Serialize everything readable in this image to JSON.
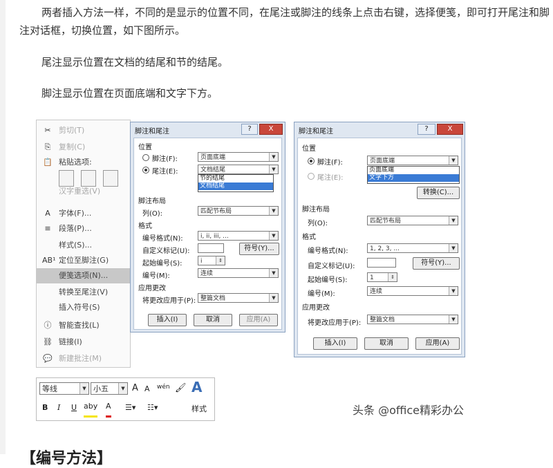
{
  "article": {
    "p1_line1": "两者插入方法一样，不同的是显示的位置不同，在尾注或脚注的线条上点击右键，选择便笺，即可打开尾注和脚",
    "p1_line2": "注对话框，切换位置，如下图所示。",
    "p2": "尾注显示位置在文档的结尾和节的结尾。",
    "p3": "脚注显示位置在页面底端和文字下方。",
    "heading": "【编号方法】"
  },
  "context_menu": {
    "items": [
      {
        "icon": "scissors-icon",
        "glyph": "✂",
        "label": "剪切(T)",
        "disabled": true
      },
      {
        "icon": "copy-icon",
        "glyph": "⎘",
        "label": "复制(C)",
        "disabled": true
      },
      {
        "icon": "paste-icon",
        "glyph": "📋",
        "label": "粘贴选项:",
        "disabled": false
      },
      {
        "icon": "",
        "glyph": "",
        "label": "汉字重选(V)",
        "disabled": true
      },
      {
        "icon": "font-icon",
        "glyph": "A",
        "label": "字体(F)...",
        "disabled": false
      },
      {
        "icon": "paragraph-icon",
        "glyph": "≡",
        "label": "段落(P)...",
        "disabled": false
      },
      {
        "icon": "",
        "glyph": "",
        "label": "样式(S)...",
        "disabled": false
      },
      {
        "icon": "footnote-icon",
        "glyph": "AB¹",
        "label": "定位至脚注(G)",
        "disabled": false
      },
      {
        "icon": "",
        "glyph": "",
        "label": "便笺选项(N)...",
        "disabled": false,
        "highlighted": true
      },
      {
        "icon": "",
        "glyph": "",
        "label": "转换至尾注(V)",
        "disabled": false
      },
      {
        "icon": "",
        "glyph": "",
        "label": "插入符号(S)",
        "disabled": false
      },
      {
        "icon": "smart-lookup-icon",
        "glyph": "ⓘ",
        "label": "智能查找(L)",
        "disabled": false
      },
      {
        "icon": "link-icon",
        "glyph": "⛓",
        "label": "链接(I)",
        "disabled": false
      },
      {
        "icon": "comment-icon",
        "glyph": "💬",
        "label": "新建批注(M)",
        "disabled": true
      }
    ]
  },
  "dialog1": {
    "title": "脚注和尾注",
    "help": "?",
    "close": "X",
    "position": "位置",
    "footnote": "脚注(F):",
    "footnote_value": "页面底端",
    "endnote": "尾注(E):",
    "endnote_value": "文档结尾",
    "dropdown": [
      "节的结尾",
      "文档结尾"
    ],
    "layout": "脚注布局",
    "columns": "列(O):",
    "columns_value": "匹配节布局",
    "format": "格式",
    "number_format": "编号格式(N):",
    "number_format_value": "i, ii, iii, ...",
    "custom_mark": "自定义标记(U):",
    "symbol_btn": "符号(Y)...",
    "start_at": "起始编号(S):",
    "start_value": "i",
    "numbering": "编号(M):",
    "numbering_value": "连续",
    "apply": "应用更改",
    "apply_to": "将更改应用于(P):",
    "apply_to_value": "整篇文档",
    "insert": "插入(I)",
    "cancel": "取消",
    "apply_btn": "应用(A)"
  },
  "dialog2": {
    "title": "脚注和尾注",
    "help": "?",
    "close": "X",
    "position": "位置",
    "footnote": "脚注(F):",
    "footnote_value": "页面底端",
    "endnote": "尾注(E):",
    "dropdown": [
      "页面底端",
      "文字下方"
    ],
    "convert_btn": "转换(C)...",
    "layout": "脚注布局",
    "columns": "列(O):",
    "columns_value": "匹配节布局",
    "format": "格式",
    "number_format": "编号格式(N):",
    "number_format_value": "1, 2, 3, ...",
    "custom_mark": "自定义标记(U):",
    "symbol_btn": "符号(Y)...",
    "start_at": "起始编号(S):",
    "start_value": "1",
    "numbering": "编号(M):",
    "numbering_value": "连续",
    "apply": "应用更改",
    "apply_to": "将更改应用于(P):",
    "apply_to_value": "整篇文档",
    "insert": "插入(I)",
    "cancel": "取消",
    "apply_btn": "应用(A)"
  },
  "mini_toolbar": {
    "font": "等线",
    "size": "小五",
    "grow": "A",
    "shrink": "A",
    "pinyin": "wén",
    "bold": "B",
    "italic": "I",
    "underline": "U",
    "highlight": "aby",
    "font_color": "A",
    "styles_label": "样式",
    "styles_icon": "A"
  },
  "watermark": "头条 @office精彩办公",
  "colors": {
    "highlight": "#c8c8c8",
    "dialog_bg": "#dfe7f1",
    "selection": "#3a7bd5",
    "close": "#c9473b"
  }
}
